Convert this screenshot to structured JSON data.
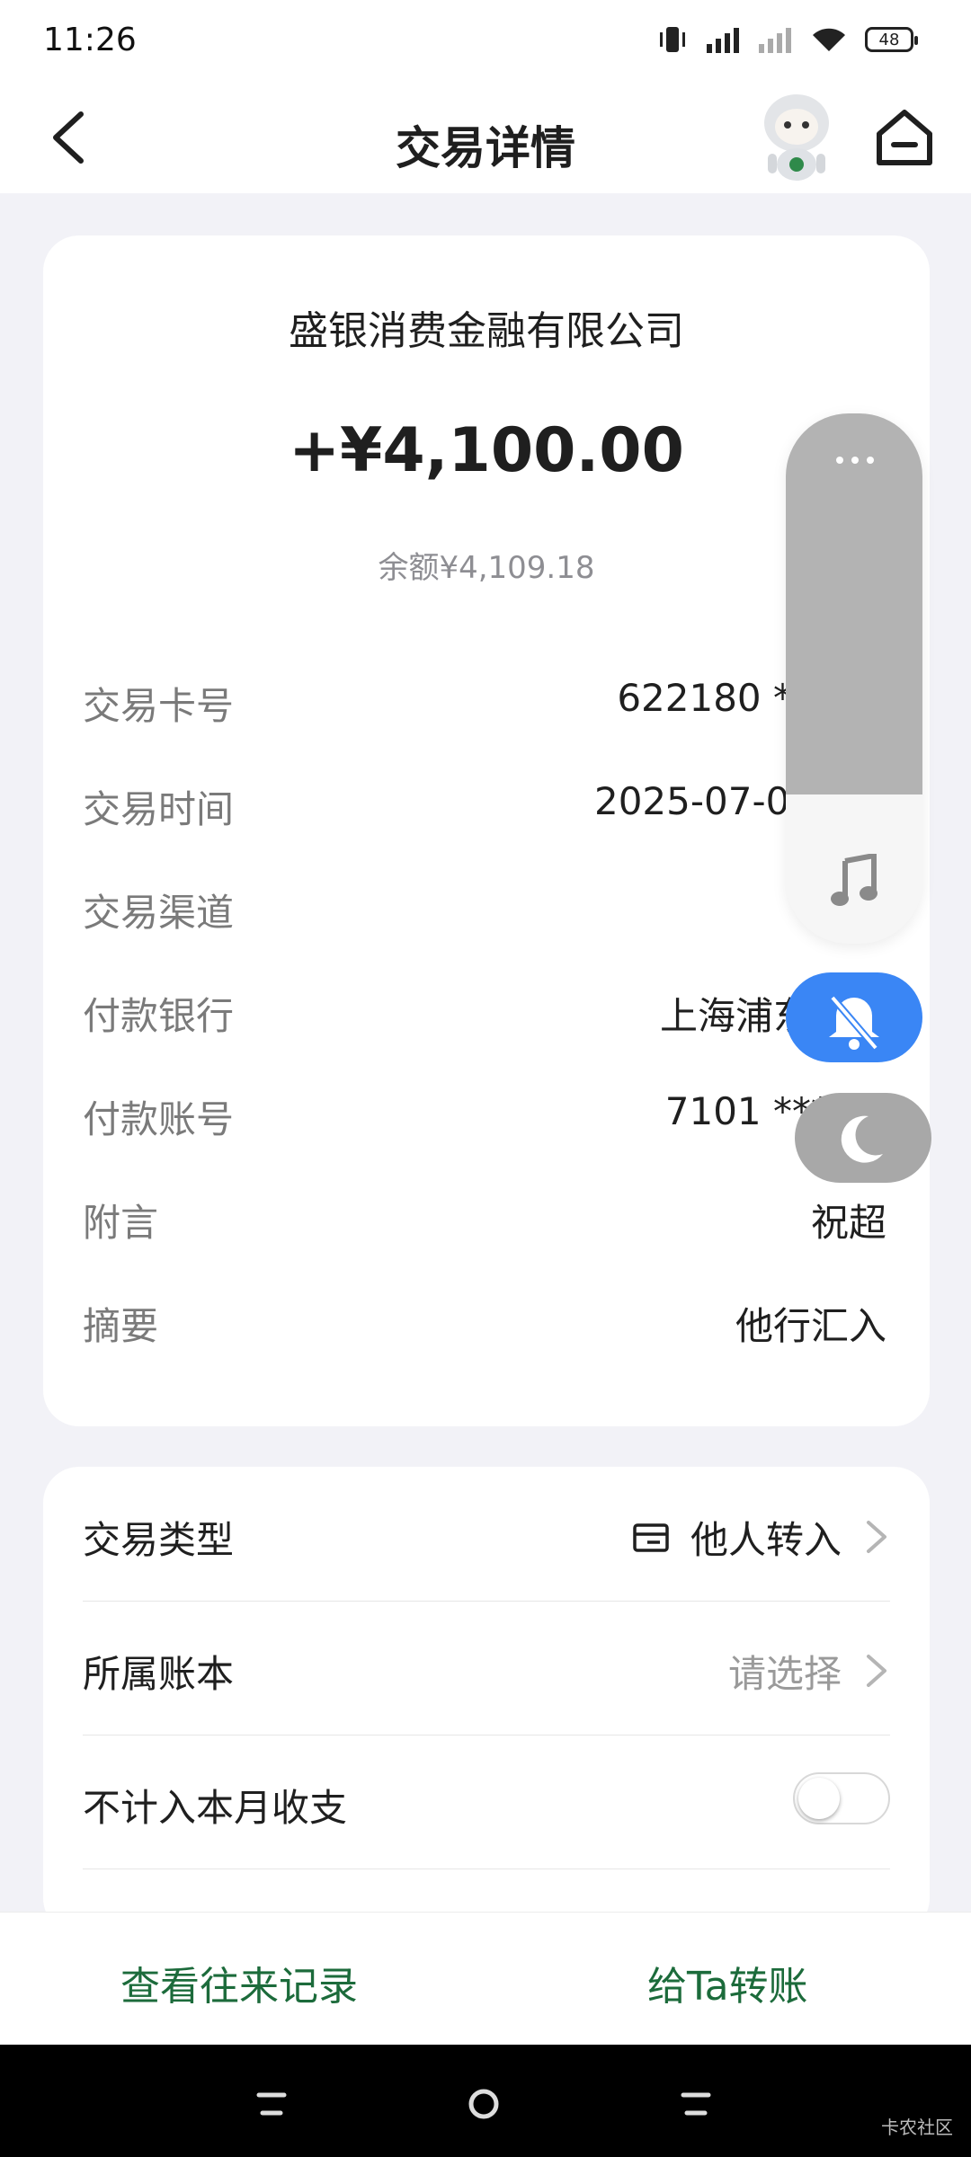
{
  "status_bar": {
    "time": "11:26",
    "battery": "48"
  },
  "header": {
    "title": "交易详情",
    "back_icon": "chevron-left-icon",
    "home_icon": "home-icon"
  },
  "transaction": {
    "counterparty": "盛银消费金融有限公司",
    "amount": "+¥4,100.00",
    "balance": "余额¥4,109.18",
    "details": [
      {
        "label": "交易卡号",
        "value": "622180 ******"
      },
      {
        "label": "交易时间",
        "value": "2025-07-06 11:"
      },
      {
        "label": "交易渠道",
        "value": ""
      },
      {
        "label": "付款银行",
        "value": "上海浦东发展"
      },
      {
        "label": "付款账号",
        "value": "7101 ******"
      },
      {
        "label": "附言",
        "value": "祝超"
      },
      {
        "label": "摘要",
        "value": "他行汇入"
      }
    ]
  },
  "settings": {
    "type_label": "交易类型",
    "type_value": "他人转入",
    "book_label": "所属账本",
    "book_value": "请选择",
    "exclude_label": "不计入本月收支",
    "exclude_on": false
  },
  "bottom": {
    "history_label": "查看往来记录",
    "transfer_label": "给Ta转账"
  },
  "watermark": "卡农社区",
  "colors": {
    "accent_green": "#1c6b3b",
    "bell_blue": "#3a86f5"
  }
}
